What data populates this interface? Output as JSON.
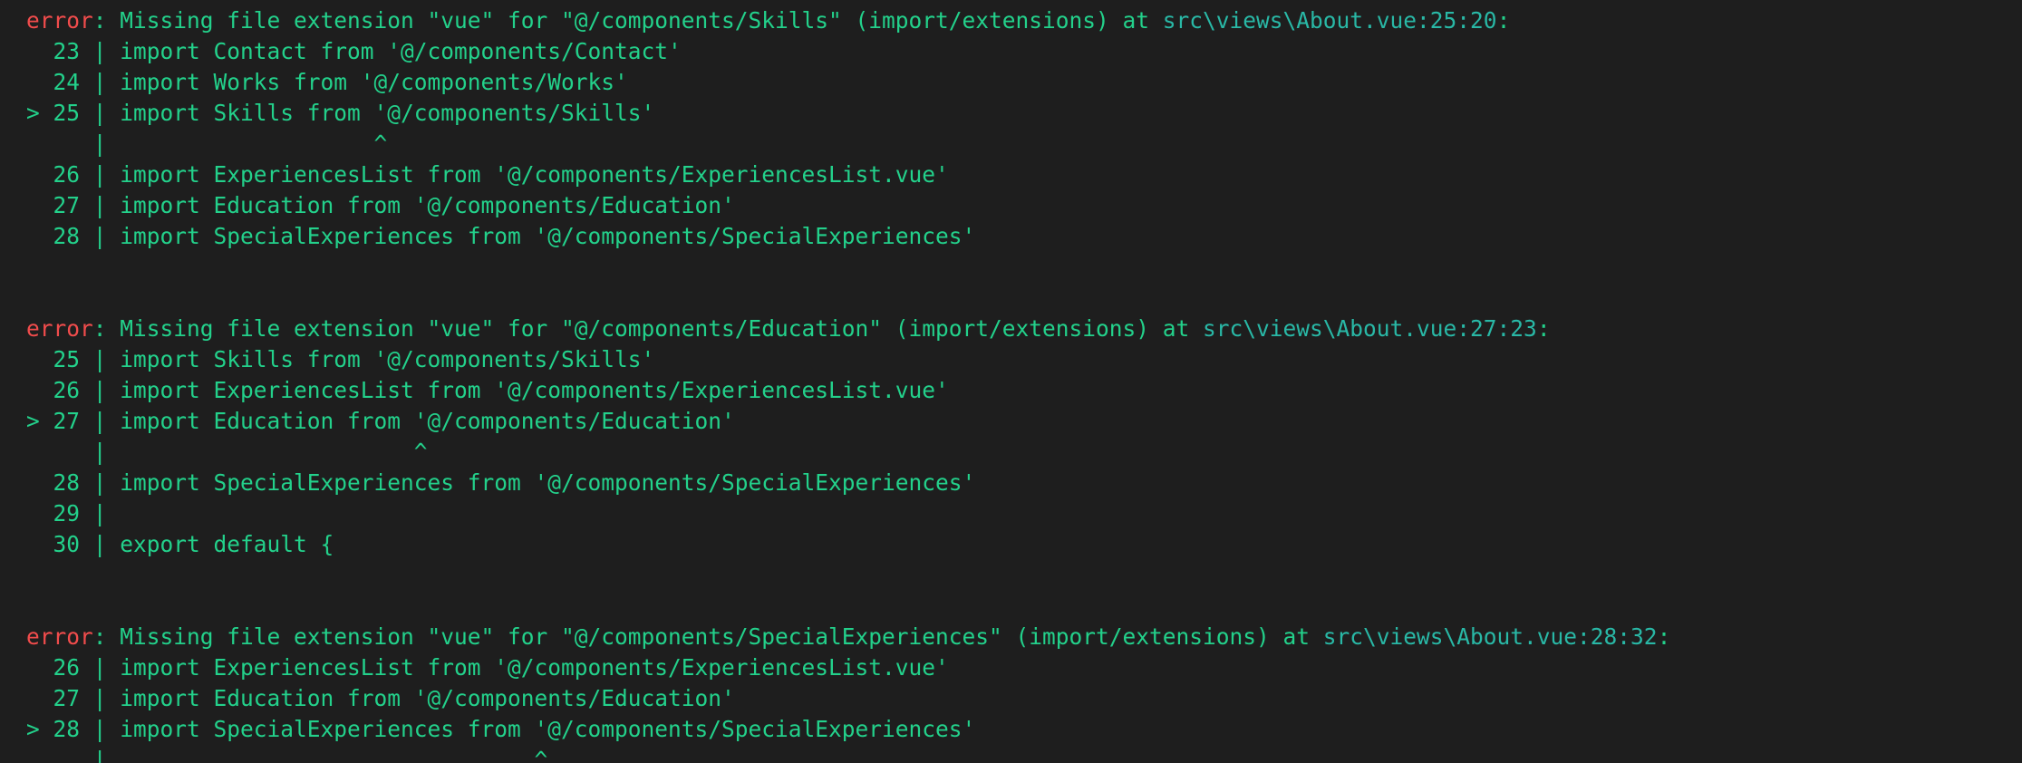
{
  "colors": {
    "background": "#1e1e1e",
    "error_keyword": "#f14c4c",
    "message_text": "#23d18b",
    "location_text": "#29b8a6"
  },
  "terminal": {
    "blocks": [
      {
        "error_label": "error",
        "message": ": Missing file extension \"vue\" for \"@/components/Skills\" (import/extensions) at ",
        "location": "src\\views\\About.vue:25:20",
        "suffix": ":",
        "lines": [
          {
            "gutter": "  23 | ",
            "code": "import Contact from '@/components/Contact'"
          },
          {
            "gutter": "  24 | ",
            "code": "import Works from '@/components/Works'"
          },
          {
            "gutter": "> 25 | ",
            "code": "import Skills from '@/components/Skills'"
          },
          {
            "gutter": "     | ",
            "code": "                   ^"
          },
          {
            "gutter": "  26 | ",
            "code": "import ExperiencesList from '@/components/ExperiencesList.vue'"
          },
          {
            "gutter": "  27 | ",
            "code": "import Education from '@/components/Education'"
          },
          {
            "gutter": "  28 | ",
            "code": "import SpecialExperiences from '@/components/SpecialExperiences'"
          }
        ]
      },
      {
        "error_label": "error",
        "message": ": Missing file extension \"vue\" for \"@/components/Education\" (import/extensions) at ",
        "location": "src\\views\\About.vue:27:23",
        "suffix": ":",
        "lines": [
          {
            "gutter": "  25 | ",
            "code": "import Skills from '@/components/Skills'"
          },
          {
            "gutter": "  26 | ",
            "code": "import ExperiencesList from '@/components/ExperiencesList.vue'"
          },
          {
            "gutter": "> 27 | ",
            "code": "import Education from '@/components/Education'"
          },
          {
            "gutter": "     | ",
            "code": "                      ^"
          },
          {
            "gutter": "  28 | ",
            "code": "import SpecialExperiences from '@/components/SpecialExperiences'"
          },
          {
            "gutter": "  29 | ",
            "code": ""
          },
          {
            "gutter": "  30 | ",
            "code": "export default {"
          }
        ]
      },
      {
        "error_label": "error",
        "message": ": Missing file extension \"vue\" for \"@/components/SpecialExperiences\" (import/extensions) at ",
        "location": "src\\views\\About.vue:28:32",
        "suffix": ":",
        "lines": [
          {
            "gutter": "  26 | ",
            "code": "import ExperiencesList from '@/components/ExperiencesList.vue'"
          },
          {
            "gutter": "  27 | ",
            "code": "import Education from '@/components/Education'"
          },
          {
            "gutter": "> 28 | ",
            "code": "import SpecialExperiences from '@/components/SpecialExperiences'"
          },
          {
            "gutter": "     | ",
            "code": "                               ^"
          }
        ]
      }
    ]
  }
}
